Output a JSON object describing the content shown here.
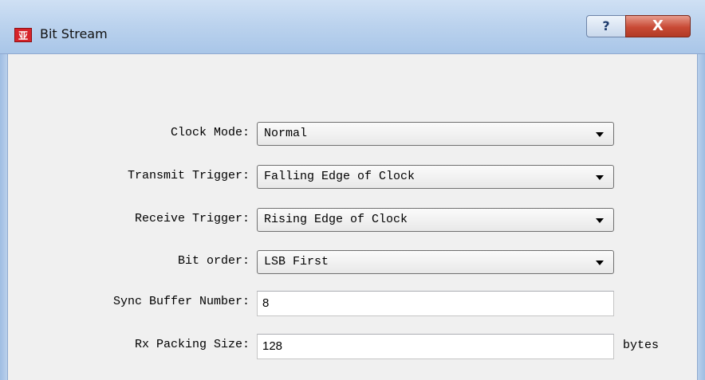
{
  "window": {
    "title": "Bit Stream",
    "icon_glyph": "亚",
    "help_button_label": "?",
    "close_button_label": "X"
  },
  "form": {
    "clock_mode": {
      "label": "Clock Mode:",
      "value": "Normal"
    },
    "transmit_trigger": {
      "label": "Transmit Trigger:",
      "value": "Falling Edge of Clock"
    },
    "receive_trigger": {
      "label": "Receive Trigger:",
      "value": "Rising Edge of Clock"
    },
    "bit_order": {
      "label": "Bit order:",
      "value": "LSB First"
    },
    "sync_buffer_number": {
      "label": "Sync Buffer Number:",
      "value": "8"
    },
    "rx_packing_size": {
      "label": "Rx Packing Size:",
      "value": "128",
      "unit": "bytes"
    }
  },
  "icons": {
    "app": "app-logo-icon",
    "help": "question-mark-icon",
    "close": "close-x-icon",
    "dropdown": "chevron-down-icon"
  }
}
